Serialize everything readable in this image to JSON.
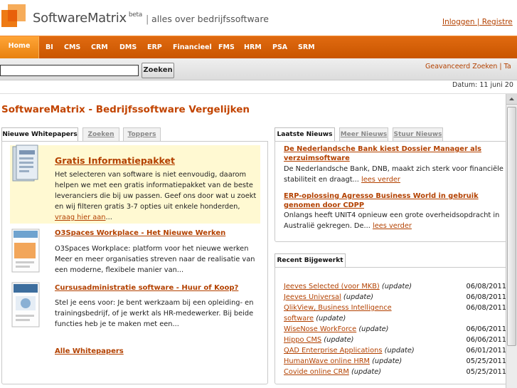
{
  "header": {
    "logo_name_1": "Software",
    "logo_name_2": "Matrix",
    "beta": "beta",
    "separator": "|",
    "tagline": "alles over bedrijfssoftware",
    "login": "Inloggen | Registre"
  },
  "nav": {
    "home": "Home",
    "items": [
      "BI",
      "CMS",
      "CRM",
      "DMS",
      "ERP",
      "Financieel",
      "FMS",
      "HRM",
      "PSA",
      "SRM"
    ]
  },
  "search": {
    "value": "",
    "button": "Zoeken",
    "advanced": "Geavanceerd Zoeken | Ta"
  },
  "date": "Datum: 11 juni 20",
  "page_title": "SoftwareMatrix - Bedrijfssoftware Vergelijken",
  "left_panel": {
    "tabs": [
      "Nieuwe Whitepapers",
      "Zoeken",
      "Toppers"
    ],
    "promo": {
      "title": "Gratis Informatiepakket",
      "text": "Het selecteren van software is niet eenvoudig, daarom helpen we met een gratis informatiepakket van de beste leveranciers die bij uw passen. Geef ons door wat u zoekt en wij filteren gratis 3-7 opties uit enkele honderden,",
      "link": "vraag hier aan",
      "tail": "..."
    },
    "whitepapers": [
      {
        "title": "O3Spaces Workplace - Het Nieuwe Werken",
        "text": "O3Spaces Workplace: platform voor het nieuwe werken Meer en meer organisaties streven naar de realisatie van een moderne, flexibele manier van..."
      },
      {
        "title": "Cursusadministratie software - Huur of Koop?",
        "text": "Stel je eens voor: Je bent werkzaam bij een opleiding- en trainingsbedrijf, of je werkt als HR-medewerker. Bij beide functies heb je te maken met een..."
      }
    ],
    "all_link": "Alle Whitepapers"
  },
  "news_panel": {
    "tabs": [
      "Laatste Nieuws",
      "Meer Nieuws",
      "Stuur Nieuws"
    ],
    "items": [
      {
        "title": "De Nederlandsche Bank kiest Dossier Manager als verzuimsoftware",
        "text": "De Nederlandsche Bank, DNB, maakt zich sterk voor financiële stabiliteit en draagt...",
        "more": "lees verder"
      },
      {
        "title": "ERP-oplossing Agresso Business World in gebruik genomen door CDPP",
        "text": "Onlangs heeft UNIT4 opnieuw een grote overheidsopdracht in Australië gekregen. De...",
        "more": "lees verder"
      }
    ]
  },
  "recent_panel": {
    "tab": "Recent Bijgewerkt",
    "rows": [
      {
        "name": "Jeeves Selected (voor MKB)",
        "tag": "(update)",
        "date": "06/08/2011"
      },
      {
        "name": "Jeeves Universal",
        "tag": "(update)",
        "date": "06/08/2011"
      },
      {
        "name": "QlikView, Business Intelligence",
        "tag": "",
        "date": "06/08/2011"
      },
      {
        "name": "software",
        "tag": "(update)",
        "date": ""
      },
      {
        "name": "WiseNose WorkForce",
        "tag": "(update)",
        "date": "06/06/2011"
      },
      {
        "name": "Hippo CMS",
        "tag": "(update)",
        "date": "06/06/2011"
      },
      {
        "name": "QAD Enterprise Applications",
        "tag": "(update)",
        "date": "06/01/2011"
      },
      {
        "name": "HumanWave online HRM",
        "tag": "(update)",
        "date": "05/25/2011"
      },
      {
        "name": "Covide online CRM",
        "tag": "(update)",
        "date": "05/25/2011"
      }
    ]
  },
  "colors": {
    "brand": "#e06a10",
    "link": "#b34100",
    "title": "#c24400",
    "promo_bg": "#fff9d2"
  }
}
